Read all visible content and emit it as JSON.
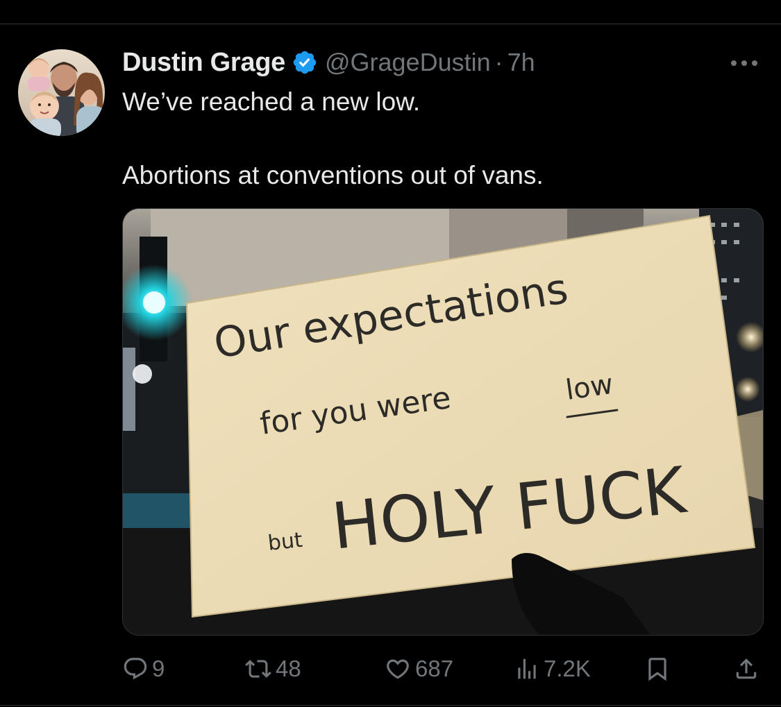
{
  "tweet": {
    "author_name": "Dustin Grage",
    "verified": true,
    "handle": "@GrageDustin",
    "separator": "·",
    "time": "7h",
    "text_line_1": "We’ve reached a new low.",
    "text_line_2": "Abortions at conventions out of vans.",
    "media": {
      "sign_line_1": "Our expectations",
      "sign_line_2_a": "for you were",
      "sign_line_2_b": "low",
      "sign_line_3_a": "but",
      "sign_line_3_b": "HOLY FUCK"
    }
  },
  "actions": {
    "replies": {
      "icon": "reply-icon",
      "count": "9"
    },
    "retweets": {
      "icon": "retweet-icon",
      "count": "48"
    },
    "likes": {
      "icon": "heart-icon",
      "count": "687"
    },
    "views": {
      "icon": "views-icon",
      "count": "7.2K"
    },
    "bookmark": {
      "icon": "bookmark-icon"
    },
    "share": {
      "icon": "share-icon"
    }
  },
  "colors": {
    "background": "#000000",
    "text_primary": "#e7e9ea",
    "text_secondary": "#71767b",
    "verified_blue": "#1d9bf0",
    "divider": "#2f3336"
  }
}
